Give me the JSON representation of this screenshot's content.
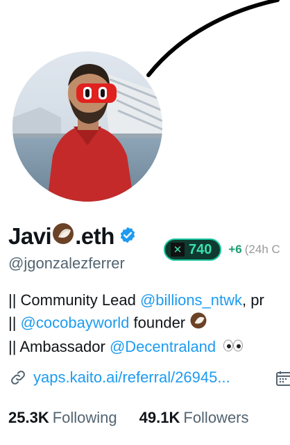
{
  "profile": {
    "name_prefix": "Javi",
    "name_suffix": ".eth",
    "handle": "@jgonzalezferrer",
    "verified": true
  },
  "kaito_badge": {
    "score": "740",
    "delta": "+6",
    "delta_label": "(24h C"
  },
  "bio": {
    "line1_prefix": "|| Community Lead ",
    "line1_link": "@billions_ntwk",
    "line1_suffix": ", pr",
    "line2_prefix": "|| ",
    "line2_link": "@cocobayworld",
    "line2_suffix": " founder",
    "line3_prefix": "|| Ambassador ",
    "line3_link": "@Decentraland"
  },
  "website": {
    "text": "yaps.kaito.ai/referral/26945..."
  },
  "stats": {
    "following_count": "25.3K",
    "following_label": "Following",
    "followers_count": "49.1K",
    "followers_label": "Followers"
  },
  "colors": {
    "link": "#1d9bf0",
    "verified": "#1d9bf0",
    "badge_green": "#3be0b0",
    "muted": "#536471"
  },
  "icons": [
    "coconut-icon",
    "verified-icon",
    "eyes-icon",
    "link-icon",
    "calendar-icon"
  ]
}
